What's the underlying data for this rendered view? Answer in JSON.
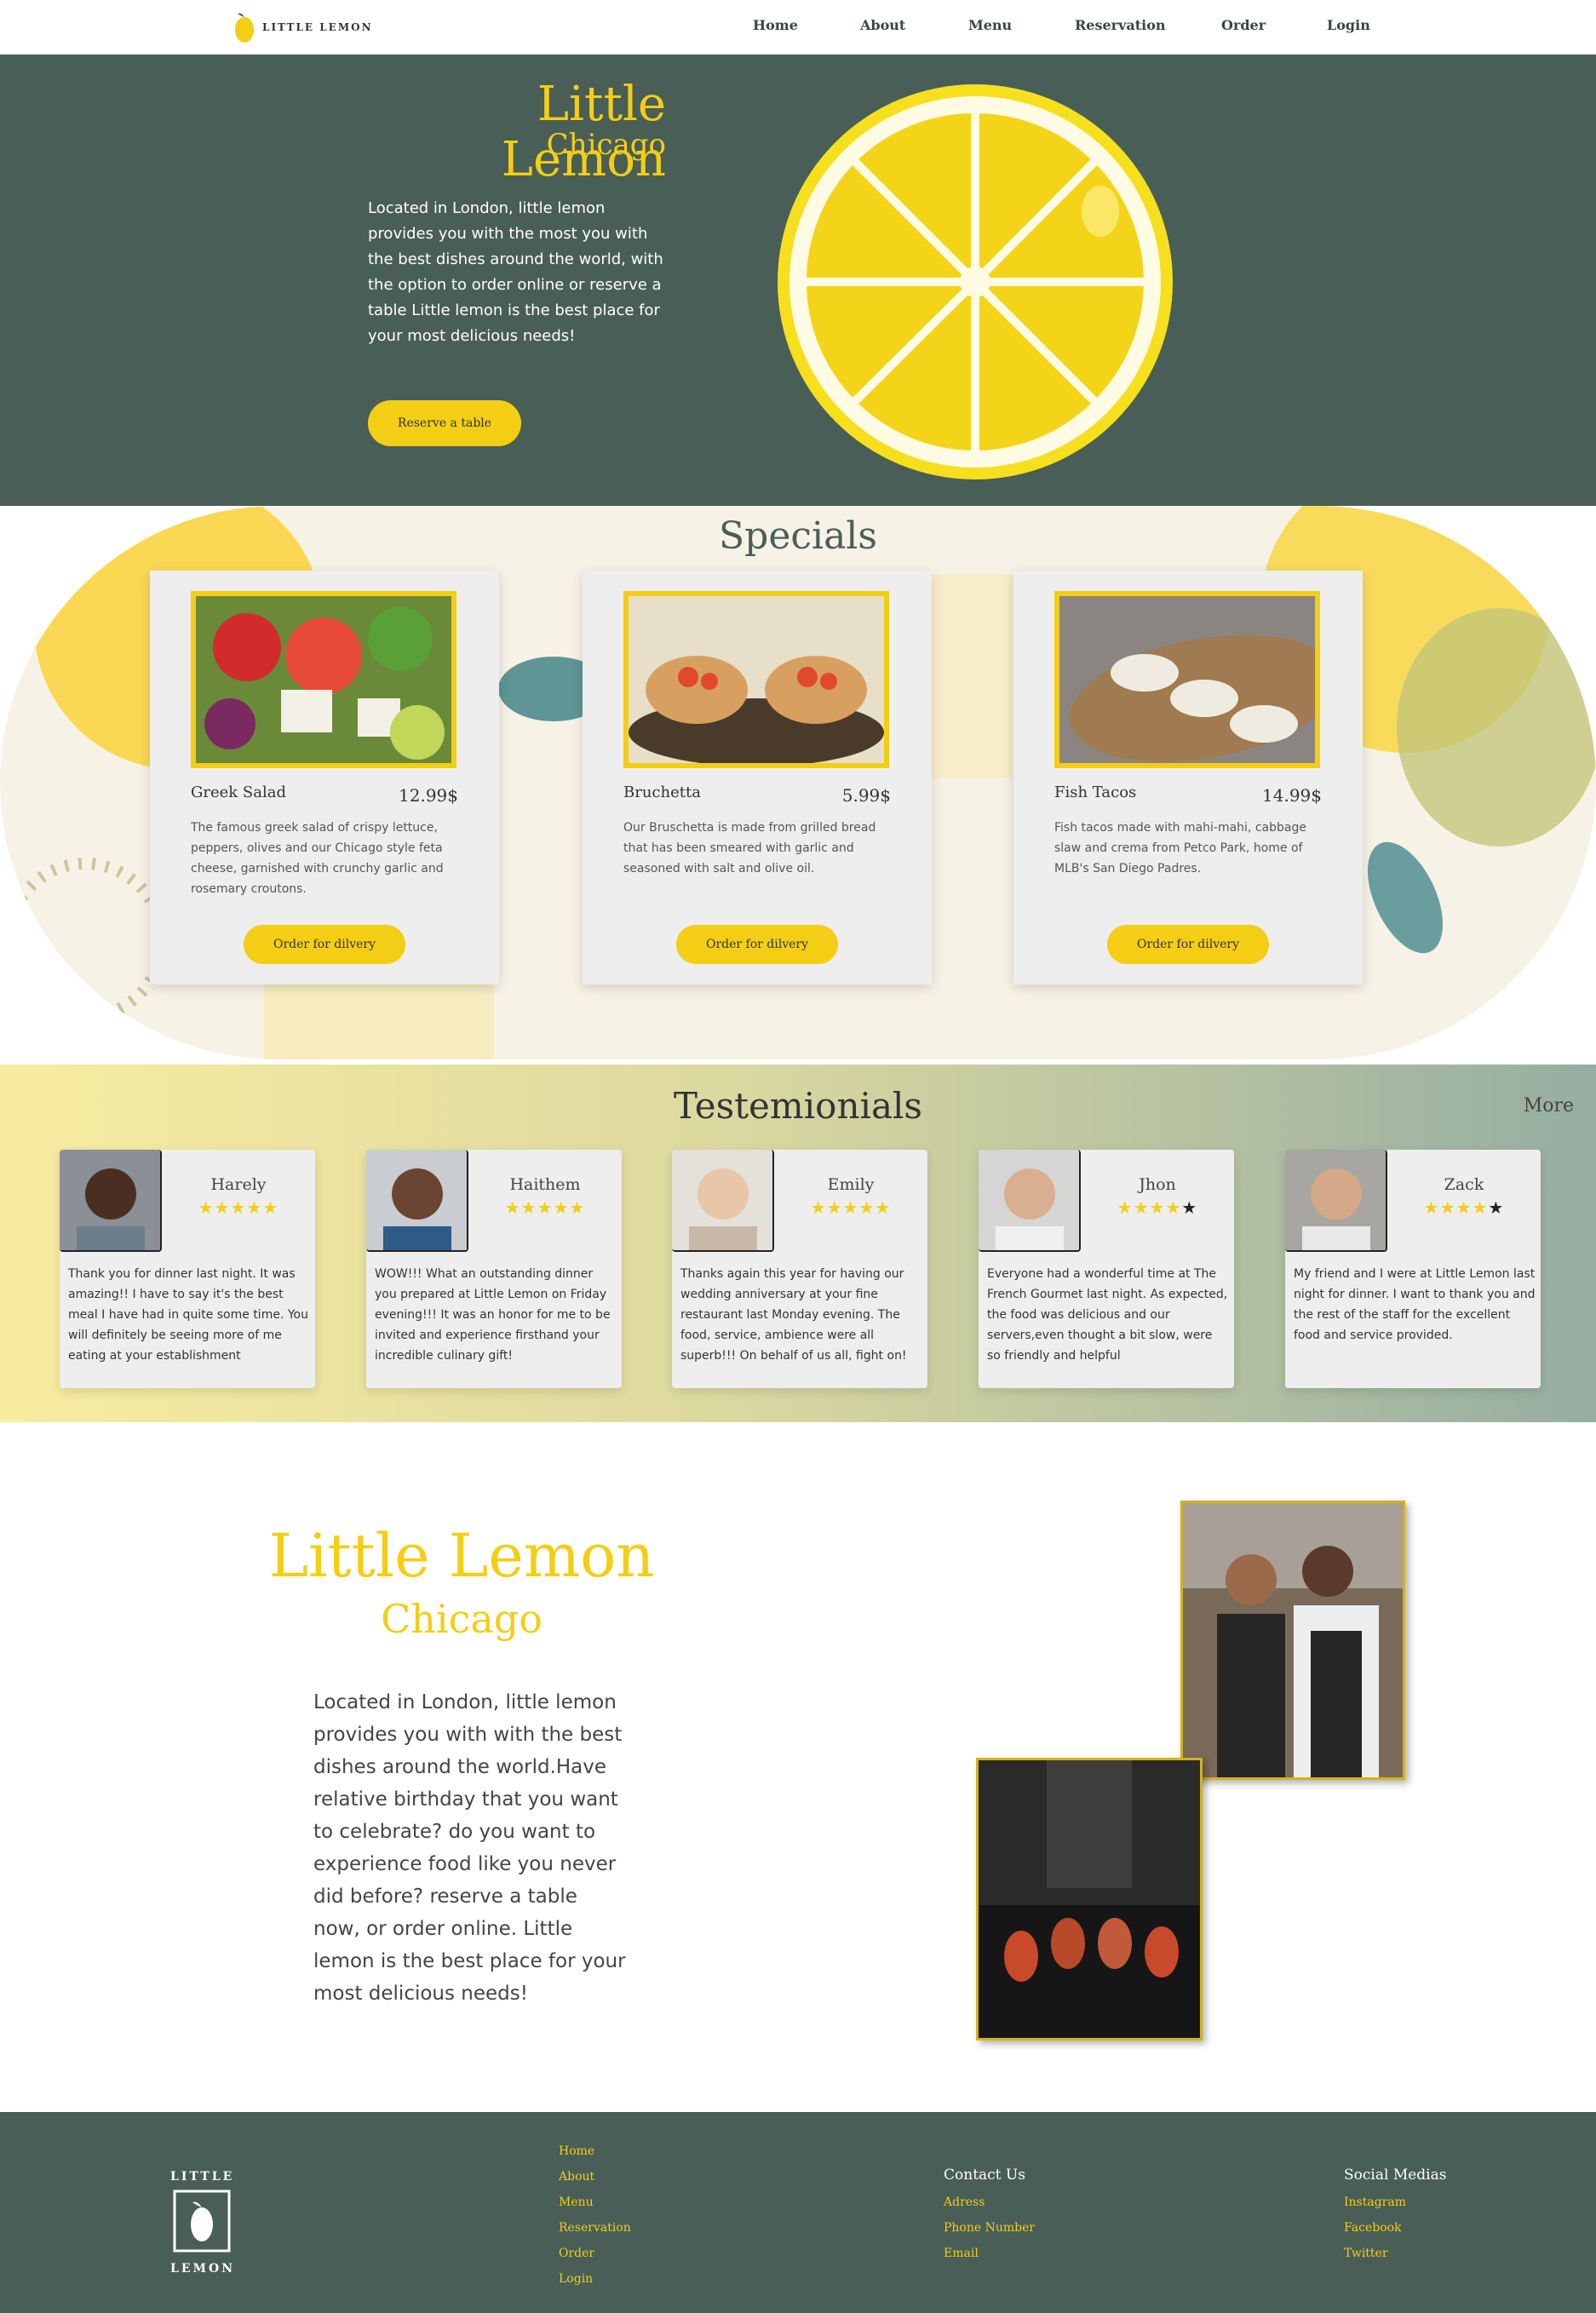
{
  "nav": {
    "logo_text": "LITTLE LEMON",
    "items": [
      "Home",
      "About",
      "Menu",
      "Reservation",
      "Order",
      "Login"
    ]
  },
  "hero": {
    "title": "Little Lemon",
    "subtitle": "Chicago",
    "description": "Located in London, little lemon provides you with the most you with the best dishes around the world, with the option to order online or reserve a table Little lemon is the best place for your most delicious needs!",
    "button": "Reserve a table"
  },
  "specials": {
    "title": "Specials",
    "cards": [
      {
        "name": "Greek Salad",
        "price": "12.99$",
        "description": "The famous greek salad of crispy lettuce, peppers, olives and our Chicago style feta cheese, garnished with crunchy garlic and rosemary croutons.",
        "button": "Order for dilvery"
      },
      {
        "name": "Bruchetta",
        "price": "5.99$",
        "description": "Our Bruschetta is made from grilled bread that has been smeared with garlic and seasoned with salt and olive oil.",
        "button": "Order for dilvery"
      },
      {
        "name": "Fish Tacos",
        "price": "14.99$",
        "description": "Fish tacos made with mahi-mahi, cabbage slaw and crema from Petco Park, home of MLB's San Diego Padres.",
        "button": "Order for dilvery"
      }
    ]
  },
  "testimonials": {
    "title": "Testemionials",
    "more": "More",
    "items": [
      {
        "name": "Harely",
        "rating": 5,
        "text": "Thank you for dinner last night. It was amazing!! I have to say it's the best meal I have had in quite some time. You will definitely be seeing more of me eating at your establishment"
      },
      {
        "name": "Haithem",
        "rating": 5,
        "text": "WOW!!! What an outstanding dinner you prepared at Little Lemon on Friday evening!!! It was an honor for me to be invited and experience firsthand your incredible culinary gift!"
      },
      {
        "name": "Emily",
        "rating": 5,
        "text": "Thanks again this year for having our wedding anniversary at your fine restaurant last Monday evening. The food, service, ambience were all superb!!! On behalf of us all, fight on!"
      },
      {
        "name": "Jhon",
        "rating": 4,
        "text": "Everyone had a wonderful time at The French Gourmet last night. As expected, the food was delicious and our servers,even thought a bit slow, were so friendly and helpful"
      },
      {
        "name": "Zack",
        "rating": 4,
        "text": "My friend and I were at Little Lemon last night for dinner. I want to thank you and the rest of the staff for the excellent food and service provided."
      }
    ]
  },
  "about": {
    "title": "Little Lemon",
    "subtitle": "Chicago",
    "description": "Located in London, little lemon provides you with with the best dishes around the world.Have relative birthday that you want to celebrate? do you want to experience food like you never did before? reserve a table now, or order online. Little lemon is the best place for your most delicious needs!"
  },
  "footer": {
    "logo_top": "LITTLE",
    "logo_bottom": "LEMON",
    "nav_links": [
      "Home",
      "About",
      "Menu",
      "Reservation",
      "Order",
      "Login"
    ],
    "contact_heading": "Contact Us",
    "contact_links": [
      "Adress",
      "Phone Number",
      "Email"
    ],
    "social_heading": "Social Medias",
    "social_links": [
      "Instagram",
      "Facebook",
      "Twitter"
    ]
  },
  "colors": {
    "primary_green": "#495e57",
    "primary_yellow": "#f4ce14",
    "card_bg": "#edeeed"
  }
}
